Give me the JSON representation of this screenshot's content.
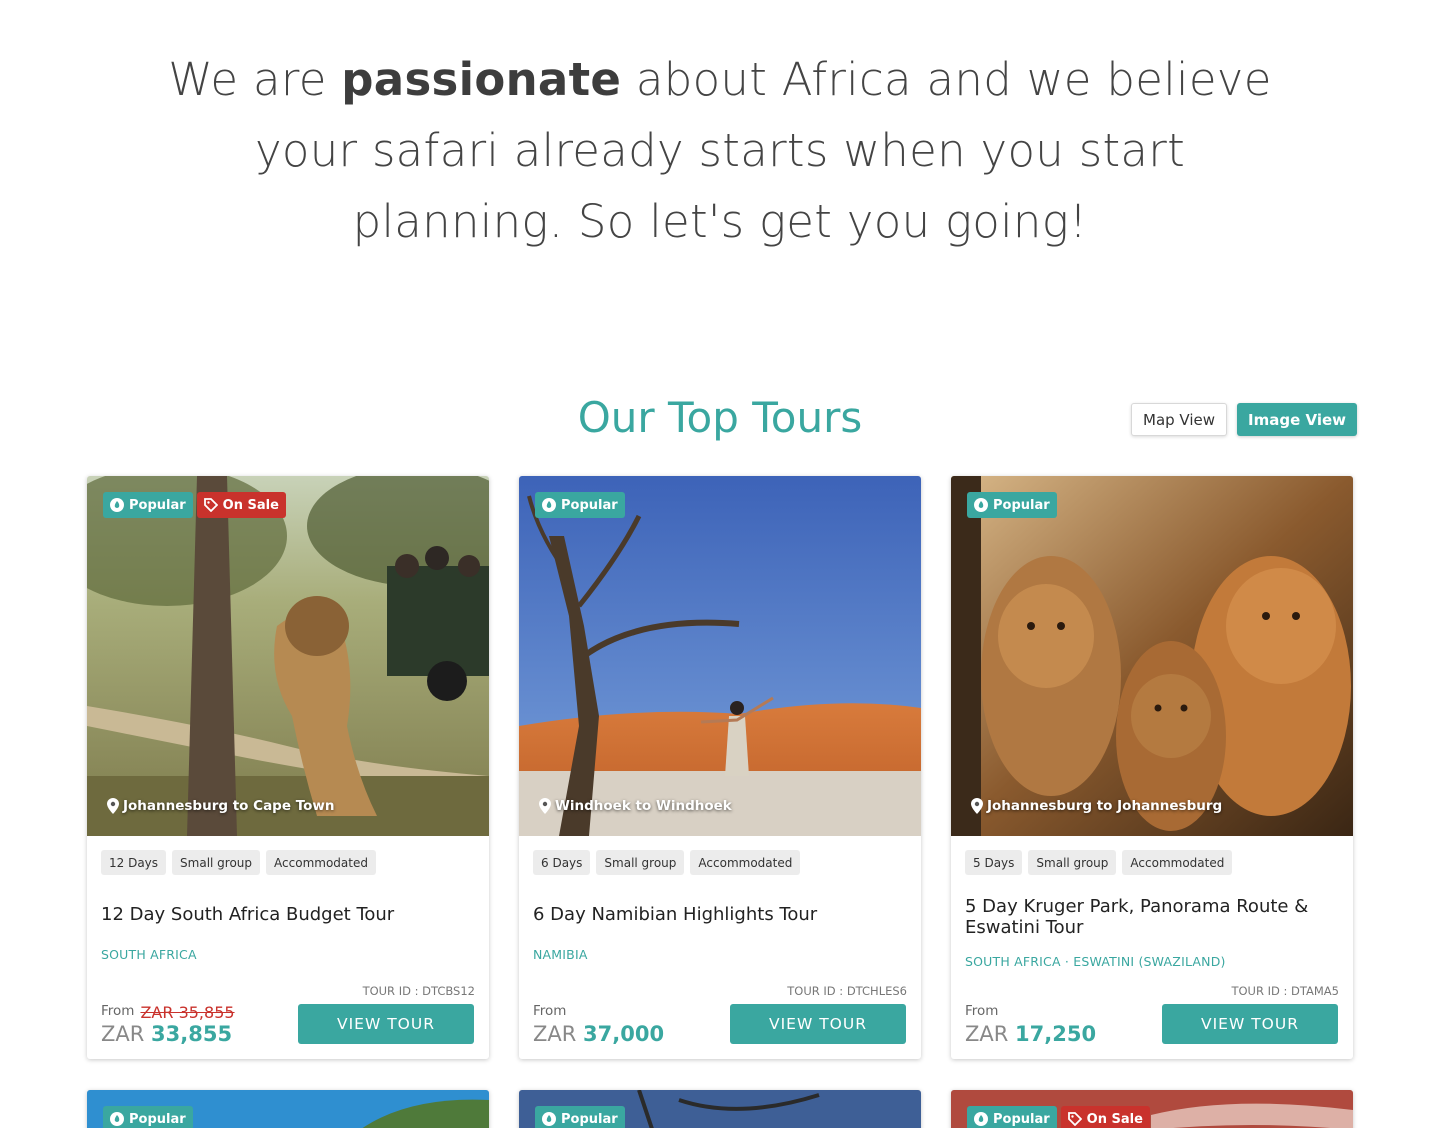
{
  "hero": {
    "line1_pre": "We are ",
    "line1_bold": "passionate",
    "line1_post": " about Africa and we believe",
    "line2": "your safari already starts when you start",
    "line3": "planning. So let's get you going!"
  },
  "section": {
    "title": "Our Top Tours",
    "map_view": "Map View",
    "image_view": "Image View"
  },
  "labels": {
    "popular": "Popular",
    "on_sale": "On Sale",
    "from": "From",
    "view_tour": "VIEW TOUR"
  },
  "tours": [
    {
      "route": "Johannesburg to Cape Town",
      "tags": [
        "12 Days",
        "Small group",
        "Accommodated"
      ],
      "title": "12 Day South Africa Budget Tour",
      "country": "SOUTH AFRICA",
      "tour_id": "TOUR ID : DTCBS12",
      "old_price": "ZAR 35,855",
      "currency": "ZAR",
      "price": "33,855"
    },
    {
      "route": "Windhoek to Windhoek",
      "tags": [
        "6 Days",
        "Small group",
        "Accommodated"
      ],
      "title": "6 Day Namibian Highlights Tour",
      "country": "NAMIBIA",
      "tour_id": "TOUR ID : DTCHLES6",
      "currency": "ZAR",
      "price": "37,000"
    },
    {
      "route": "Johannesburg to Johannesburg",
      "tags": [
        "5 Days",
        "Small group",
        "Accommodated"
      ],
      "title": "5 Day Kruger Park, Panorama Route & Eswatini Tour",
      "country": "SOUTH AFRICA · ESWATINI (SWAZILAND)",
      "tour_id": "TOUR ID : DTAMA5",
      "currency": "ZAR",
      "price": "17,250"
    }
  ],
  "colors": {
    "accent": "#3aa7a0",
    "sale": "#c9322c"
  },
  "icons": {
    "popular": "flame-icon",
    "sale": "tag-icon",
    "route": "map-pin-icon"
  }
}
